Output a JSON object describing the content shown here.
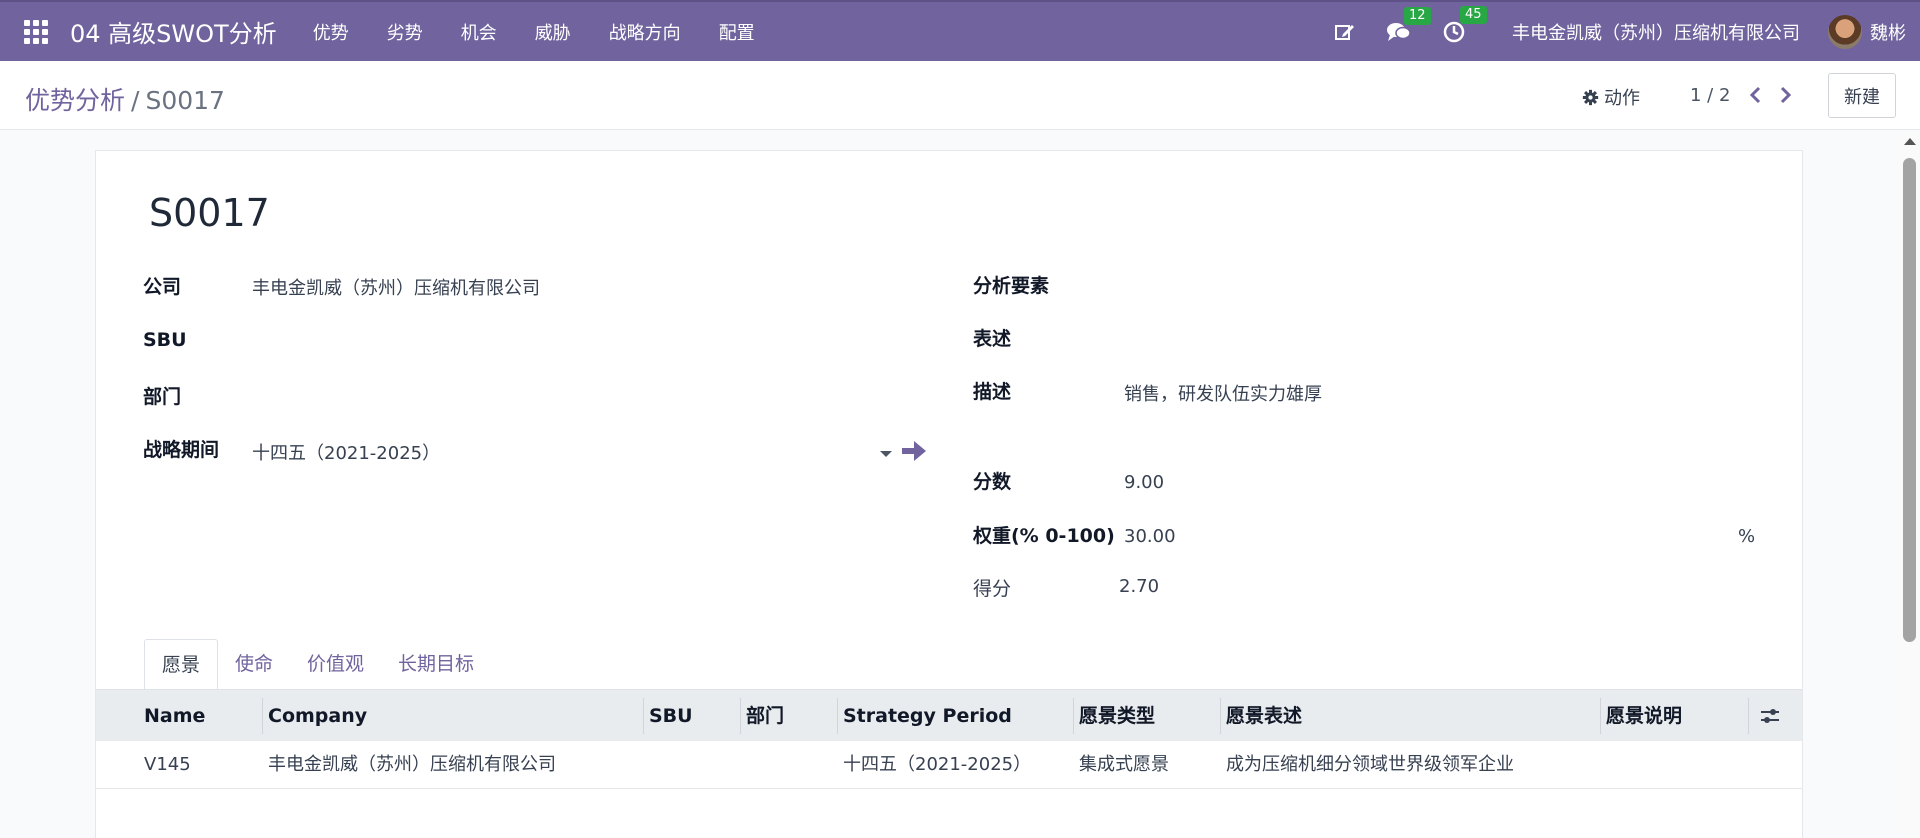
{
  "navbar": {
    "app_title": "04 高级SWOT分析",
    "menu": [
      "优势",
      "劣势",
      "机会",
      "威胁",
      "战略方向",
      "配置"
    ],
    "messages_count": "12",
    "activities_count": "45",
    "company": "丰电金凯威（苏州）压缩机有限公司",
    "user": "魏彬",
    "accent_color": "#71639e"
  },
  "control": {
    "breadcrumb_parent": "优势分析",
    "breadcrumb_sep": "/",
    "breadcrumb_current": "S0017",
    "actions_label": "动作",
    "pager": "1 / 2",
    "new_label": "新建"
  },
  "form": {
    "title": "S0017",
    "company_label": "公司",
    "company_value": "丰电金凯威（苏州）压缩机有限公司",
    "sbu_label": "SBU",
    "department_label": "部门",
    "period_label": "战略期间",
    "period_value": "十四五（2021-2025）",
    "element_label": "分析要素",
    "statement_label": "表述",
    "description_label": "描述",
    "description_value": "销售，研发队伍实力雄厚",
    "score_label": "分数",
    "score_value": "9.00",
    "weight_label": "权重(% 0-100)",
    "weight_value": "30.00",
    "weight_unit": "%",
    "result_label": "得分",
    "result_value": "2.70"
  },
  "tabs": [
    "愿景",
    "使命",
    "价值观",
    "长期目标"
  ],
  "table": {
    "headers": [
      "Name",
      "Company",
      "SBU",
      "部门",
      "Strategy Period",
      "愿景类型",
      "愿景表述",
      "愿景说明"
    ],
    "rows": [
      [
        "V145",
        "丰电金凯威（苏州）压缩机有限公司",
        "",
        "",
        "十四五（2021-2025）",
        "集成式愿景",
        "成为压缩机细分领域世界级领军企业",
        ""
      ]
    ]
  }
}
